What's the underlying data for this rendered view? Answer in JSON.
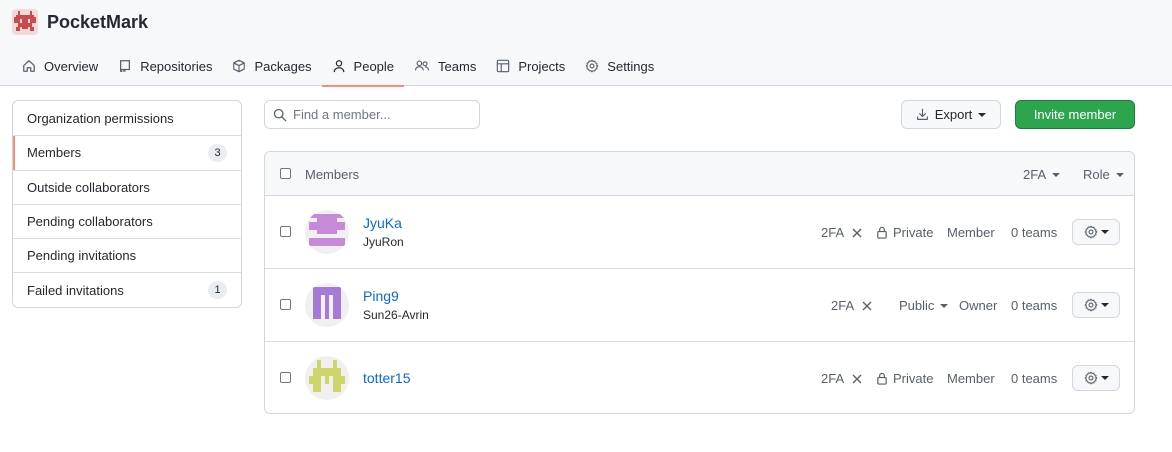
{
  "org": {
    "name": "PocketMark",
    "avatar_icon": "pixel-invader-logo",
    "avatar_color": "#c94b4b"
  },
  "nav": {
    "tabs": [
      {
        "label": "Overview",
        "icon": "home-icon"
      },
      {
        "label": "Repositories",
        "icon": "repo-icon"
      },
      {
        "label": "Packages",
        "icon": "package-icon"
      },
      {
        "label": "People",
        "icon": "person-icon",
        "active": true
      },
      {
        "label": "Teams",
        "icon": "people-icon"
      },
      {
        "label": "Projects",
        "icon": "table-icon"
      },
      {
        "label": "Settings",
        "icon": "gear-icon"
      }
    ]
  },
  "sidebar": {
    "items": [
      {
        "label": "Organization permissions"
      },
      {
        "label": "Members",
        "count": "3",
        "selected": true
      },
      {
        "label": "Outside collaborators"
      },
      {
        "label": "Pending collaborators"
      },
      {
        "label": "Pending invitations"
      },
      {
        "label": "Failed invitations",
        "count": "1"
      }
    ]
  },
  "toolbar": {
    "search_placeholder": "Find a member...",
    "export_label": "Export",
    "invite_label": "Invite member"
  },
  "table": {
    "header_label": "Members",
    "filter_2fa": "2FA",
    "filter_role": "Role",
    "rows": [
      {
        "username": "JyuKa",
        "fullname": "JyuRon",
        "twofa": "2FA",
        "visibility": "Private",
        "role": "Member",
        "teams": "0 teams",
        "avatar_color": "#c78ad9"
      },
      {
        "username": "Ping9",
        "fullname": "Sun26-Avrin",
        "twofa": "2FA",
        "visibility": "Public",
        "role": "Owner",
        "teams": "0 teams",
        "avatar_color": "#a77ad6"
      },
      {
        "username": "totter15",
        "fullname": "",
        "twofa": "2FA",
        "visibility": "Private",
        "role": "Member",
        "teams": "0 teams",
        "avatar_color": "#cdd66a"
      }
    ]
  },
  "colors": {
    "accent_underline": "#fd8c73",
    "primary_button": "#2da44e",
    "link": "#0969da"
  }
}
